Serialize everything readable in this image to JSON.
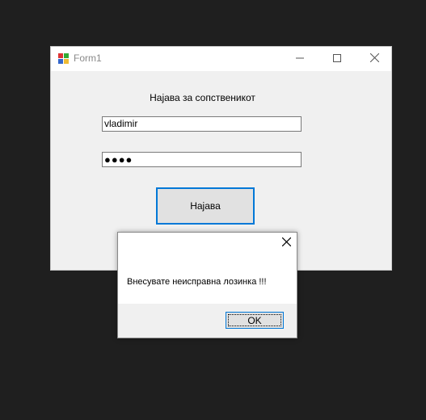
{
  "window": {
    "title": "Form1",
    "heading": "Најава за сопственикот",
    "username_value": "vladimir",
    "password_value": "●●●●",
    "login_button": "Најава"
  },
  "dialog": {
    "message": "Внесувате неисправна лозинка !!!",
    "ok_button": "OK"
  },
  "icons": {
    "app": "app-icon",
    "minimize": "minimize-icon",
    "maximize": "maximize-icon",
    "close": "close-icon"
  },
  "colors": {
    "accent": "#0078d7",
    "desktop": "#1f1f1f"
  }
}
